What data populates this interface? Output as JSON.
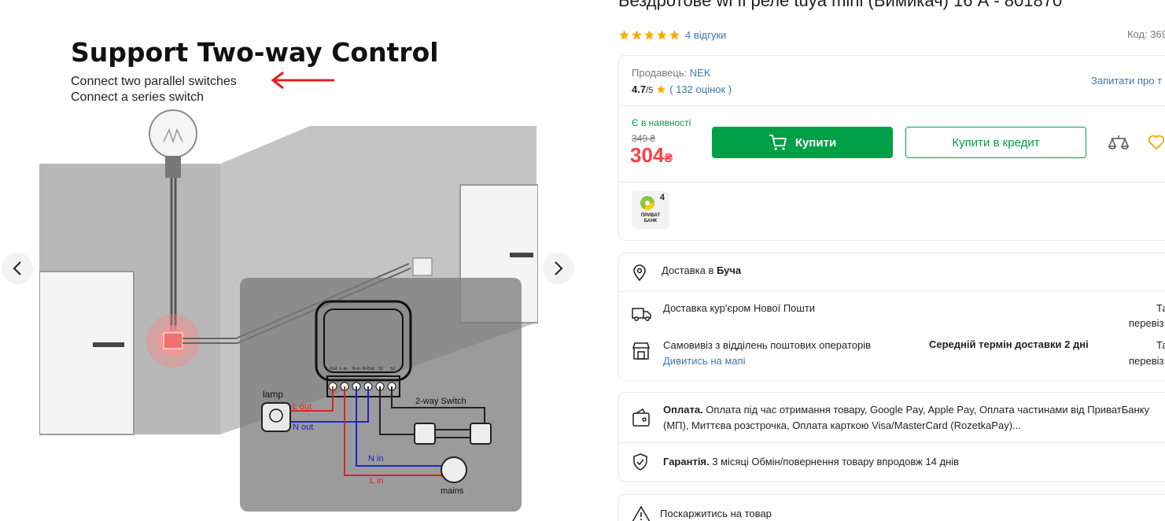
{
  "gallery": {
    "image": {
      "headline": "Support Two-way Control",
      "line1": "Connect two parallel switches",
      "line2": "Connect a series switch",
      "terminals": [
        "L-Out",
        "L-In",
        "N-In",
        "N-Out",
        "S1",
        "S2"
      ],
      "lamp": "lamp",
      "l_out": "L out",
      "n_out": "N out",
      "two_way_switch": "2-way Switch",
      "n_in": "N in",
      "l_in": "L in",
      "mains": "mains"
    },
    "prev_icon": "chevron-left-icon",
    "next_icon": "chevron-right-icon"
  },
  "product": {
    "title": "Бездротове wi fi реле tuya mini (Вимикач) 16 А - 801870",
    "reviews": "4 відгуки",
    "code": "Код:  369"
  },
  "seller": {
    "label": "Продавець:",
    "name": "NEK",
    "rating": "4.7",
    "rating_of": "/5",
    "ratings_link": "( 132 оцінок )",
    "ask": "Запитати про т"
  },
  "offer": {
    "availability": "Є в наявності",
    "old_price": "349 ₴",
    "price": "304",
    "currency": "₴",
    "buy": "Купити",
    "credit": "Купити в кредит",
    "privat_count": "4",
    "privat_name": "ПРИВАТ\nБАНК"
  },
  "delivery": {
    "city_label": "Доставка в",
    "city": "Буча",
    "courier": "Доставка кур'єром Нової Пошти",
    "courier_right1": "Та",
    "courier_right2": "перевіз",
    "pickup": "Самовивіз з відділень поштових операторів",
    "map_link": "Дивитись на мапі",
    "avg_term": "Середній термін доставки 2 дні",
    "pickup_right1": "Та",
    "pickup_right2": "перевіз"
  },
  "payment": {
    "label": "Оплата.",
    "text": "Оплата під час отримання товару, Google Pay, Apple Pay, Оплата частинами від ПриватБанку (МП), Миттєва розстрочка, Оплата карткою Visa/MasterCard (RozetkaPay)...",
    "warranty_label": "Гарантія.",
    "warranty_text": "3 місяці Обмін/повернення товару впродовж 14 днів"
  },
  "complain": {
    "text": "Поскаржитись на товар"
  },
  "colors": {
    "green": "#00a046",
    "red": "#f84147",
    "link": "#3e77aa",
    "star": "#ffa900"
  }
}
